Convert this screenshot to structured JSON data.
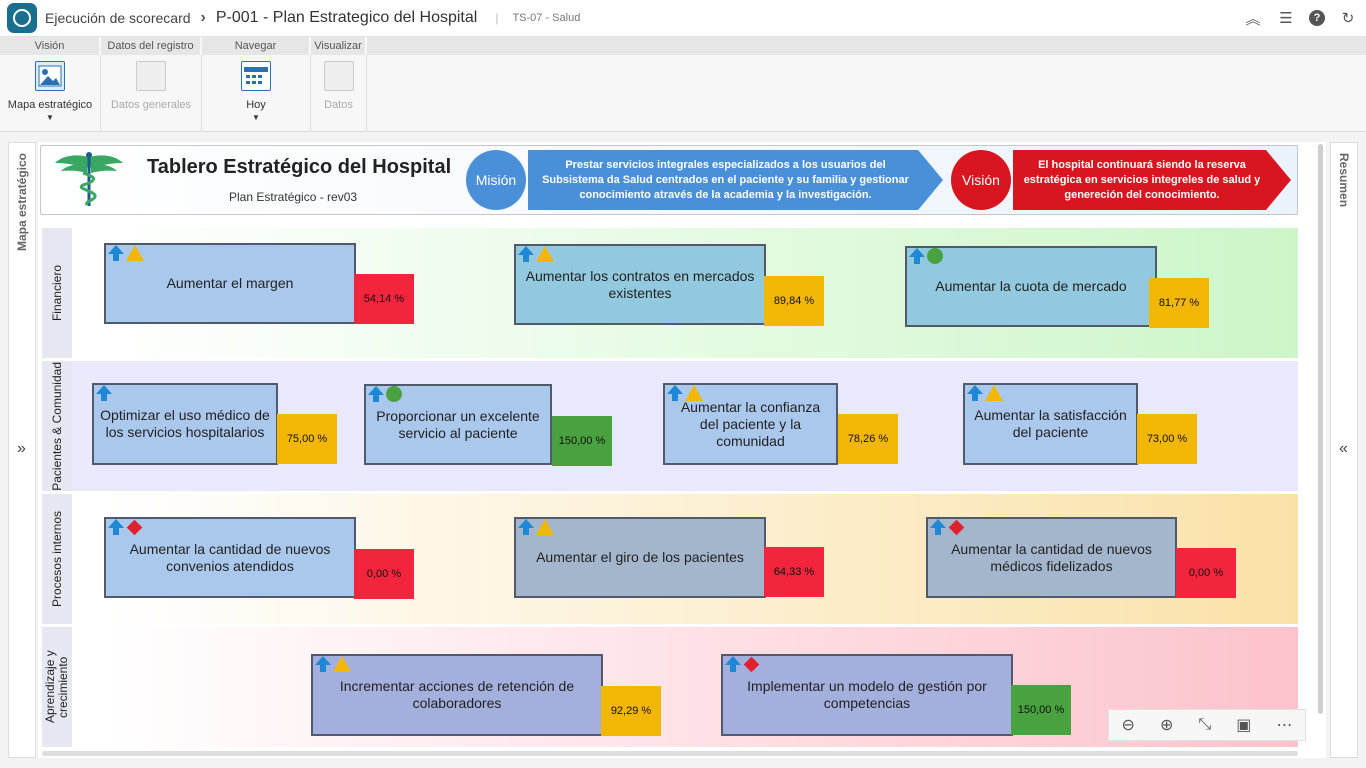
{
  "titlebar": {
    "breadcrumb_root": "Ejecución de scorecard",
    "breadcrumb_page": "P-001 - Plan Estrategico del Hospital",
    "breadcrumb_tag": "TS-07 - Salud"
  },
  "ribbon": {
    "groups": [
      "Visión",
      "Datos del registro",
      "Navegar",
      "Visualizar"
    ],
    "buttons": {
      "mapa": "Mapa estratégico",
      "datos_generales": "Datos generales",
      "hoy": "Hoy",
      "datos": "Datos"
    }
  },
  "side": {
    "left_label": "Mapa estratégico",
    "right_label": "Resumen"
  },
  "header": {
    "title": "Tablero Estratégico del Hospital",
    "subtitle": "Plan Estratégico - rev03",
    "mision_label": "Misión",
    "mision_text": "Prestar servicios integrales especializados a los usuarios del Subsistema da Salud centrados en el paciente y su familia y gestionar conocimiento através de la academia y la investigación.",
    "vision_label": "Visión",
    "vision_text": "El hospital continuará siendo la reserva estratégica en servicios integreles de salud y genereción del conocimiento."
  },
  "perspectives": {
    "financiero": "Financiero",
    "pacientes": "Pacientes & Comunidad",
    "procesos": "Procesos internos",
    "aprendizaje": "Aprendizaje y crecimiento"
  },
  "objectives": [
    {
      "label": "Aumentar el margen",
      "value": "54,14 %",
      "status": "red-triangle"
    },
    {
      "label": "Aumentar los contratos en mercados existentes",
      "value": "89,84 %",
      "status": "yellow-triangle"
    },
    {
      "label": "Aumentar la cuota de mercado",
      "value": "81,77 %",
      "status": "green-circle"
    },
    {
      "label": "Optimizar el uso médico de los servicios hospitalarios",
      "value": "75,00 %",
      "status": "none"
    },
    {
      "label": "Proporcionar un excelente servicio al paciente",
      "value": "150,00 %",
      "status": "green-circle"
    },
    {
      "label": "Aumentar la confianza del paciente y la comunidad",
      "value": "78,26 %",
      "status": "yellow-triangle"
    },
    {
      "label": "Aumentar la satisfacción del paciente",
      "value": "73,00 %",
      "status": "yellow-triangle"
    },
    {
      "label": "Aumentar la cantidad de nuevos convenios atendidos",
      "value": "0,00 %",
      "status": "red-diamond"
    },
    {
      "label": "Aumentar el giro de los pacientes",
      "value": "64,33 %",
      "status": "yellow-triangle"
    },
    {
      "label": "Aumentar la cantidad de nuevos médicos fidelizados",
      "value": "0,00 %",
      "status": "red-diamond"
    },
    {
      "label": "Incrementar acciones de retención de colaboradores",
      "value": "92,29 %",
      "status": "yellow-triangle"
    },
    {
      "label": "Implementar un modelo de gestión por competencias",
      "value": "150,00 %",
      "status": "red-diamond"
    }
  ],
  "colors": {
    "mision": "#4a90d9",
    "vision": "#d9161f",
    "value_red": "#f3253c",
    "value_yellow": "#f2b705",
    "value_green": "#4aa13f"
  }
}
